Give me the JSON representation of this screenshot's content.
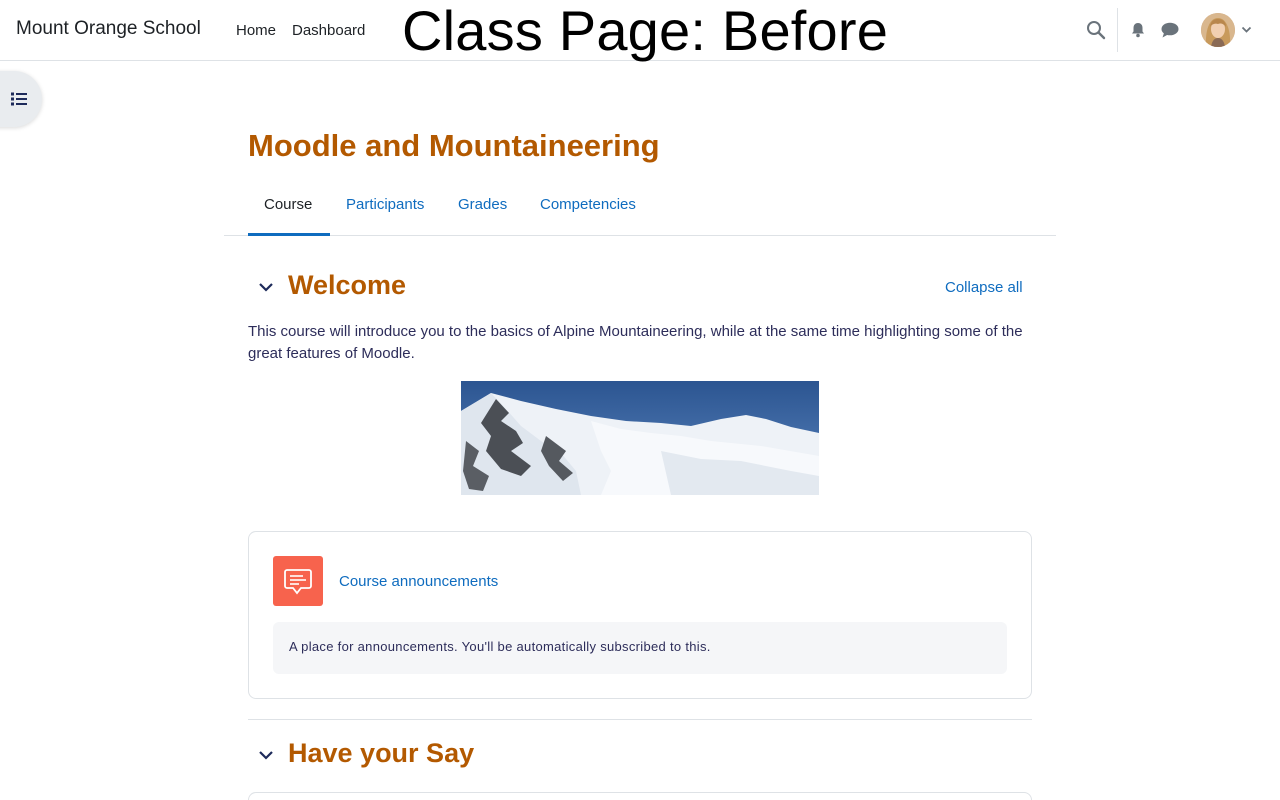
{
  "navbar": {
    "site_name": "Mount Orange School",
    "links": [
      "Home",
      "Dashboard"
    ],
    "overlay_title": "Class Page: Before",
    "icons": [
      "search-icon",
      "bell-icon",
      "chat-icon",
      "chevron-down-icon"
    ]
  },
  "course": {
    "title": "Moodle and Mountaineering",
    "tabs": [
      "Course",
      "Participants",
      "Grades",
      "Competencies"
    ],
    "active_tab": "Course"
  },
  "sections": [
    {
      "title": "Welcome",
      "summary": "This course will introduce you to the basics of Alpine Mountaineering, while at the same time highlighting some of the great features of Moodle.",
      "activity": {
        "name": "Course announcements",
        "description": "A place for announcements. You'll be automatically subscribed to this.",
        "icon": "forum-icon"
      }
    },
    {
      "title": "Have your Say"
    }
  ],
  "controls": {
    "collapse_all": "Collapse all"
  },
  "colors": {
    "brand_orange": "#b35900",
    "link_blue": "#0f6cbf",
    "forum_icon_bg": "#f7634d"
  }
}
